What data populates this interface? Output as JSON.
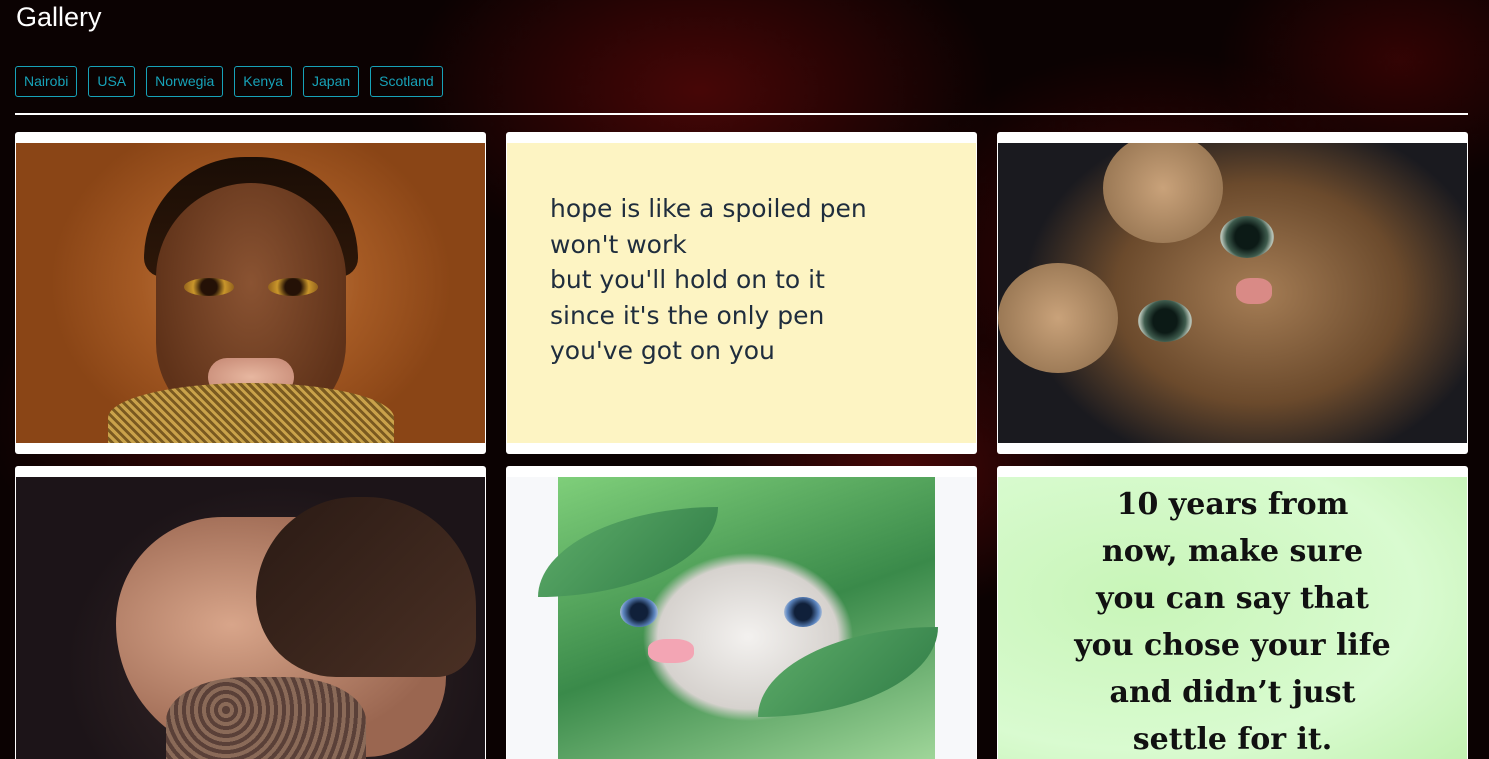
{
  "header": {
    "title": "Gallery"
  },
  "filters": [
    "Nairobi",
    "USA",
    "Norwegia",
    "Kenya",
    "Japan",
    "Scotland"
  ],
  "cards": [
    {
      "image": "portrait-woman"
    },
    {
      "image": "quote-card",
      "lines": [
        "hope is like a spoiled pen",
        "won't work",
        "but you'll hold on to it",
        "since it's the only pen",
        "you've got on you"
      ]
    },
    {
      "image": "cat-photo"
    },
    {
      "image": "portrait-man"
    },
    {
      "image": "kitten-in-leaves"
    },
    {
      "image": "quote-card",
      "lines": [
        "10 years from",
        "now, make sure",
        "you can say that",
        "you chose your life",
        "and didn’t just",
        "settle for it."
      ]
    }
  ],
  "colors": {
    "accent": "#17a2b8",
    "background": "#0b0202",
    "card": "#ffffff"
  }
}
